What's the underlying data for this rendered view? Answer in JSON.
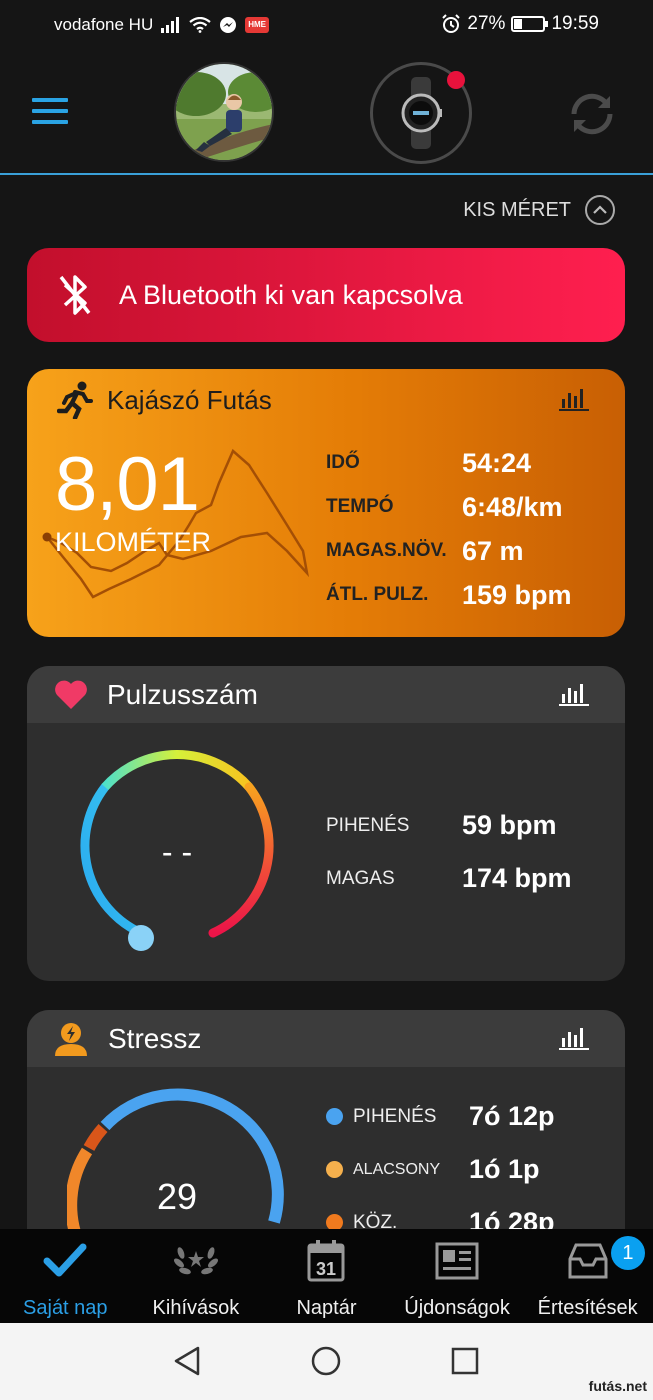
{
  "status_bar": {
    "carrier": "vodafone HU",
    "hme_badge": "HME",
    "battery_percent": "27%",
    "battery_level": 0.27,
    "time": "19:59"
  },
  "header": {
    "menu_icon": "hamburger-icon",
    "avatar": "profile-photo",
    "device_icon": "watch-icon",
    "sync_icon": "sync-icon"
  },
  "view_toggle": {
    "label": "KIS MÉRET"
  },
  "bluetooth_banner": {
    "text": "A Bluetooth ki van kapcsolva",
    "color": "#e8123c"
  },
  "activity": {
    "title": "Kajászó Futás",
    "distance": "8,01",
    "distance_unit": "KILOMÉTER",
    "stats": [
      {
        "label": "IDŐ",
        "value": "54:24"
      },
      {
        "label": "TEMPÓ",
        "value": "6:48/km"
      },
      {
        "label": "MAGAS.NÖV.",
        "value": "67 m"
      },
      {
        "label": "ÁTL. PULZ.",
        "value": "159 bpm"
      }
    ]
  },
  "heart_rate": {
    "title": "Pulzusszám",
    "current": "- -",
    "stats": [
      {
        "label": "PIHENÉS",
        "value": "59 bpm"
      },
      {
        "label": "MAGAS",
        "value": "174 bpm"
      }
    ]
  },
  "stress": {
    "title": "Stressz",
    "value": "29",
    "stats": [
      {
        "label": "PIHENÉS",
        "value": "7ó 12p",
        "color": "#4aa3f0"
      },
      {
        "label": "ALACSONY",
        "value": "1ó 1p",
        "color": "#f5b04d"
      },
      {
        "label": "KÖZ.",
        "value": "1ó 28p",
        "color": "#f07a1e"
      }
    ]
  },
  "bottom_nav": {
    "items": [
      {
        "label": "Saját nap",
        "icon": "checkmark-icon"
      },
      {
        "label": "Kihívások",
        "icon": "laurel-icon"
      },
      {
        "label": "Naptár",
        "icon": "calendar-icon",
        "day": "31"
      },
      {
        "label": "Újdonságok",
        "icon": "newspaper-icon"
      },
      {
        "label": "Értesítések",
        "icon": "inbox-icon",
        "badge": "1"
      }
    ]
  },
  "watermark": "futás.net"
}
